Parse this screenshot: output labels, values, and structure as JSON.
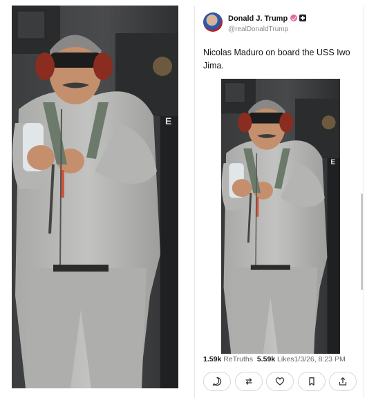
{
  "post": {
    "author_name": "Donald J. Trump",
    "author_handle": "@realDonaldTrump",
    "text": "Nicolas Maduro on board the USS Iwo Jima.",
    "retruths_count": "1.59k",
    "retruths_label": "ReTruths",
    "likes_count": "5.59k",
    "likes_label": "Likes",
    "timestamp": "1/3/26, 8:23 PM"
  },
  "icons": {
    "verified": "verified-badge-icon",
    "plus": "plus-badge-icon",
    "reply": "reply-icon",
    "retruth": "retruth-icon",
    "like": "heart-icon",
    "bookmark": "bookmark-icon",
    "share": "share-icon"
  },
  "colors": {
    "verified_badge": "#e36aa1",
    "sweatsuit": "#b9b9b7",
    "background": "#ffffff"
  }
}
